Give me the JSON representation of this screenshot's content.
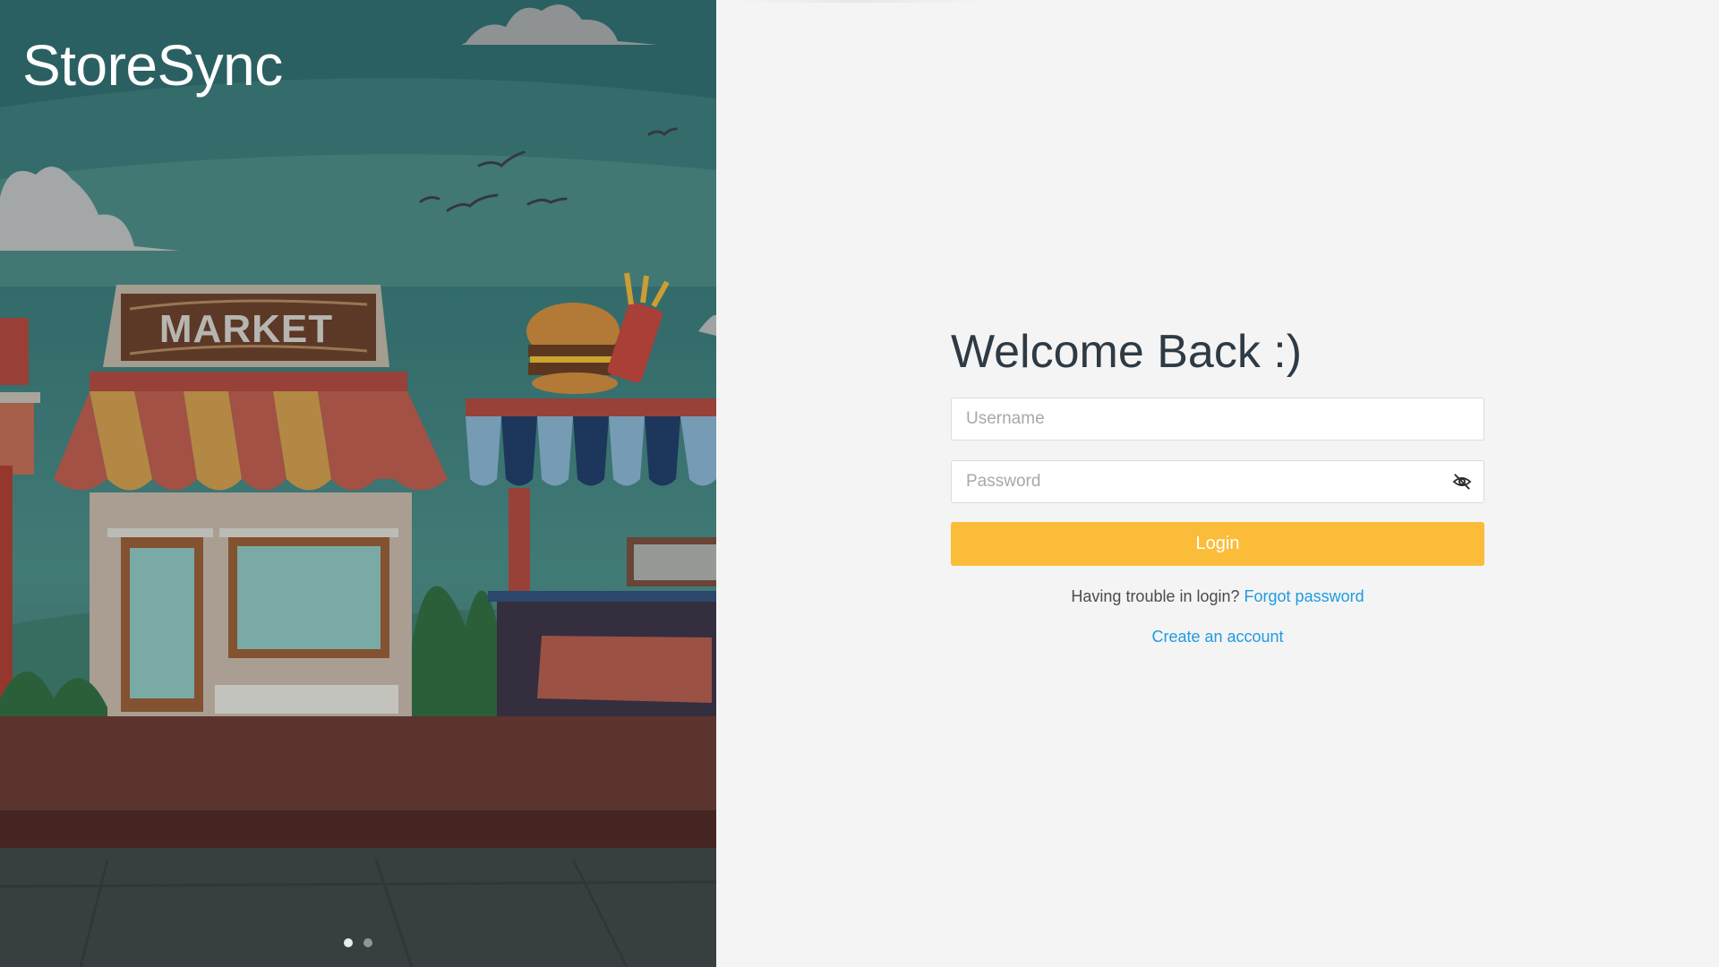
{
  "brand": {
    "name": "StoreSync"
  },
  "hero": {
    "illustration": "market-storefront-illustration",
    "carousel": {
      "slide_count": 2,
      "active_index": 0
    }
  },
  "login": {
    "title": "Welcome Back :)",
    "username": {
      "placeholder": "Username",
      "value": ""
    },
    "password": {
      "placeholder": "Password",
      "value": "",
      "toggle_icon": "eye-off-icon"
    },
    "submit_label": "Login",
    "trouble_text": "Having trouble in login?",
    "forgot_label": "Forgot password",
    "create_account_label": "Create an account"
  },
  "colors": {
    "accent_button": "#fbbd39",
    "link": "#1e9be0",
    "title_text": "#2e3a44",
    "panel_bg": "#f4f4f4"
  }
}
